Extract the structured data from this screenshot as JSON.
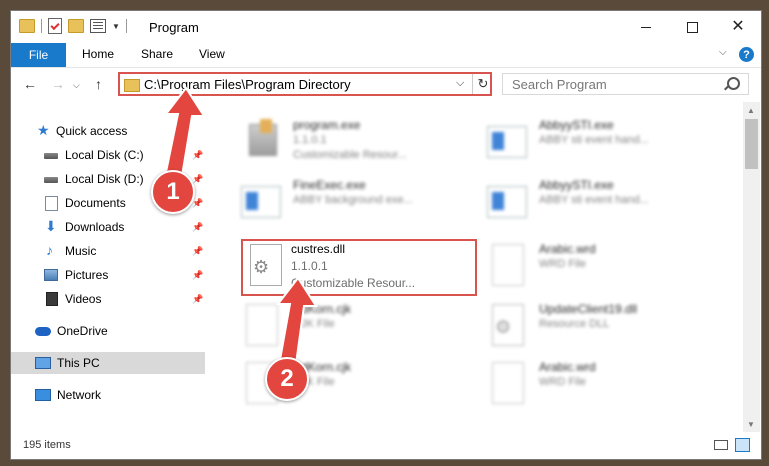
{
  "window": {
    "title": "Program",
    "controls": {
      "minimize": "minimize",
      "maximize": "maximize",
      "close": "close"
    }
  },
  "ribbon": {
    "tabs": [
      "File",
      "Home",
      "Share",
      "View"
    ]
  },
  "nav": {
    "address": "C:\\Program Files\\Program Directory",
    "search_placeholder": "Search Program"
  },
  "sidebar": {
    "items": [
      {
        "label": "Quick access",
        "icon": "star-icon"
      },
      {
        "label": "Local Disk (C:)",
        "icon": "drive-icon"
      },
      {
        "label": "Local Disk (D:)",
        "icon": "drive-icon"
      },
      {
        "label": "Documents",
        "icon": "documents-icon"
      },
      {
        "label": "Downloads",
        "icon": "download-icon"
      },
      {
        "label": "Music",
        "icon": "music-icon"
      },
      {
        "label": "Pictures",
        "icon": "pictures-icon"
      },
      {
        "label": "Videos",
        "icon": "videos-icon"
      },
      {
        "label": "OneDrive",
        "icon": "cloud-icon"
      },
      {
        "label": "This PC",
        "icon": "computer-icon"
      },
      {
        "label": "Network",
        "icon": "network-icon"
      }
    ]
  },
  "files": [
    {
      "name": "program.exe",
      "line1": "1.1.0.1",
      "line2": "Customizable Resour...",
      "icon": "exe-icon"
    },
    {
      "name": "AbbyySTI.exe",
      "line1": "ABBY sti event hand...",
      "line2": "",
      "icon": "app-icon"
    },
    {
      "name": "FineExec.exe",
      "line1": "ABBY background exe...",
      "line2": "",
      "icon": "app-icon"
    },
    {
      "name": "AbbyySTI.exe",
      "line1": "ABBY sti event hand...",
      "line2": "",
      "icon": "app-icon"
    },
    {
      "name": "custres.dll",
      "line1": "1.1.0.1",
      "line2": "Customizable Resour...",
      "icon": "gear-file-icon"
    },
    {
      "name": "Arabic.wrd",
      "line1": "WRD File",
      "line2": "",
      "icon": "document-icon"
    },
    {
      "name": "BdKorn.cjk",
      "line1": "CJK File",
      "line2": "",
      "icon": "document-icon"
    },
    {
      "name": "UpdateClient19.dll",
      "line1": "Resource DLL",
      "line2": "",
      "icon": "gear-file-icon"
    },
    {
      "name": "BdKorn.cjk",
      "line1": "CJK File",
      "line2": "",
      "icon": "document-icon"
    },
    {
      "name": "Arabic.wrd",
      "line1": "WRD File",
      "line2": "",
      "icon": "document-icon"
    }
  ],
  "status": {
    "count": "195 items"
  },
  "annotations": {
    "step1": "1",
    "step2": "2",
    "color": "#e2463f"
  },
  "colors": {
    "accent": "#1979ca",
    "highlight": "#d9534f",
    "selection": "#d9d9d9"
  }
}
